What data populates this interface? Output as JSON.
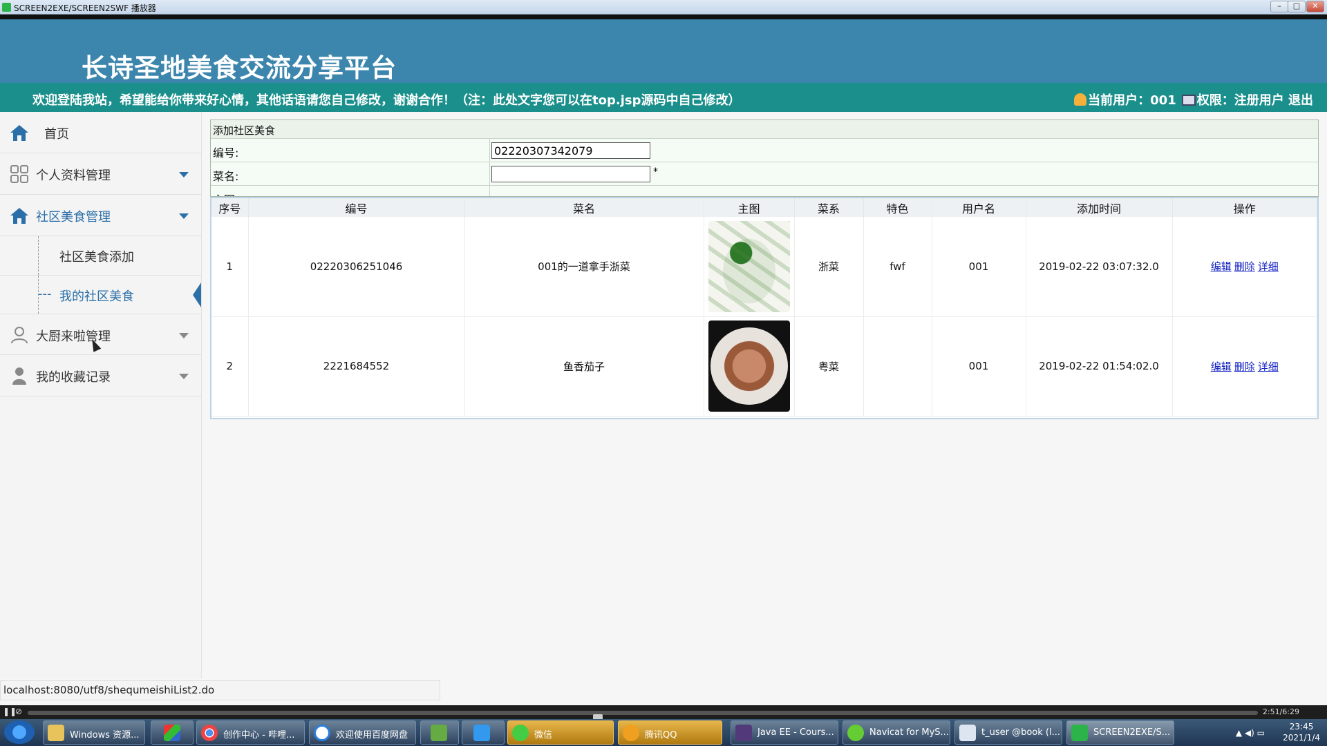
{
  "window": {
    "title": "SCREEN2EXE/SCREEN2SWF 播放器",
    "min": "–",
    "max": "□",
    "close": "✕"
  },
  "header": {
    "site_title": "长诗圣地美食交流分享平台"
  },
  "notice": {
    "text": "欢迎登陆我站，希望能给你带来好心情，其他话语请您自己修改，谢谢合作！（注：此处文字您可以在top.jsp源码中自己修改）",
    "user_label": "当前用户：",
    "user_value": "001",
    "perm_label": "权限：",
    "perm_value": "注册用户",
    "logout": "退出"
  },
  "sidebar": {
    "home": "首页",
    "profile": "个人资料管理",
    "community": "社区美食管理",
    "sub_add": "社区美食添加",
    "sub_mine_prefix": "---",
    "sub_mine": "我的社区美食",
    "chef": "大厨来啦管理",
    "favorites": "我的收藏记录"
  },
  "form": {
    "heading": "添加社区美食",
    "id_label": "编号:",
    "id_value": "02220307342079",
    "name_label": "菜名:",
    "name_value": "",
    "required": "*",
    "image_label": "主图"
  },
  "table": {
    "headers": [
      "序号",
      "编号",
      "菜名",
      "主图",
      "菜系",
      "特色",
      "用户名",
      "添加时间",
      "操作"
    ],
    "rows": [
      {
        "no": "1",
        "id": "02220306251046",
        "name": "001的一道拿手浙菜",
        "cuisine": "浙菜",
        "feature": "fwf",
        "user": "001",
        "time": "2019-02-22 03:07:32.0"
      },
      {
        "no": "2",
        "id": "2221684552",
        "name": "鱼香茄子",
        "cuisine": "粤菜",
        "feature": "",
        "user": "001",
        "time": "2019-02-22 01:54:02.0"
      }
    ],
    "actions": {
      "edit": "编辑",
      "delete": "删除",
      "detail": "详细"
    }
  },
  "status_url": "localhost:8080/utf8/shequmeishiList2.do",
  "player": {
    "time": "2:51/6:29",
    "play": "❚❚",
    "stop": "⊘"
  },
  "taskbar": {
    "items": [
      "Windows 资源...",
      "",
      "创作中心 - 哔哩...",
      "欢迎使用百度网盘",
      "",
      "",
      "微信",
      "腾讯QQ",
      "Java EE - Cours...",
      "Navicat for MyS...",
      "t_user @book (l...",
      "SCREEN2EXE/S..."
    ],
    "clock_time": "23:45",
    "clock_date": "2021/1/4"
  },
  "colors": {
    "header": "#3c86ad",
    "notice": "#1a8f8b",
    "accent": "#2b6fa8",
    "link": "#1020c0"
  }
}
